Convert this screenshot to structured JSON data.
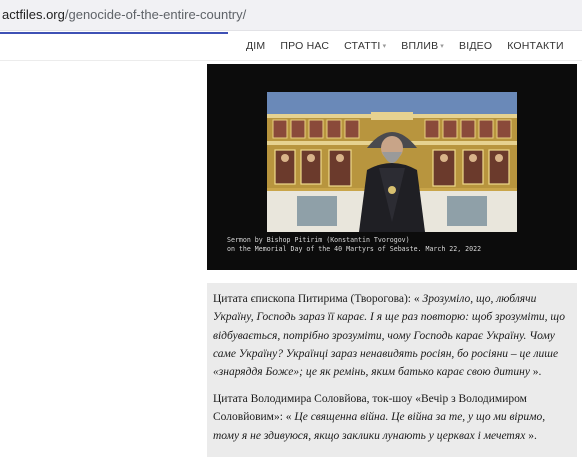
{
  "browser": {
    "url_domain": "actfiles.org",
    "url_path": "/genocide-of-the-entire-country/"
  },
  "nav": {
    "items": [
      {
        "label": "ДІМ"
      },
      {
        "label": "ПРО НАС"
      },
      {
        "label": "СТАТТІ"
      },
      {
        "label": "ВПЛИВ"
      },
      {
        "label": "ВІДЕО"
      },
      {
        "label": "КОНТАКТИ"
      }
    ]
  },
  "video": {
    "caption_line1": "Sermon by Bishop Pitirim (Konstantin Tvorogov)",
    "caption_line2": "on the Memorial Day of the 40 Martyrs of Sebaste. March 22, 2022"
  },
  "quote1": {
    "intro": "Цитата єпископа Питирима (Творогова): « ",
    "text": "Зрозуміло, що, люблячи Україну, Господь зараз її карає. І я ще раз повторю: щоб зрозуміти, що відбувається, потрібно зрозуміти, чому Господь карає Україну. Чому саме Україну? Українці зараз ненавидять росіян, бо росіяни – це лише «знаряддя Боже»; це як ремінь, яким батько карає свою дитину",
    "outro": " »."
  },
  "quote2": {
    "intro": "Цитата Володимира Соловйова, ток-шоу «Вечір з Володимиром Соловйовим»: « ",
    "text": "Це священна війна. Це війна за те, у що ми віримо, тому я не здивуюся, якщо заклики лунають у церквах і мечетях",
    "outro": " »."
  }
}
